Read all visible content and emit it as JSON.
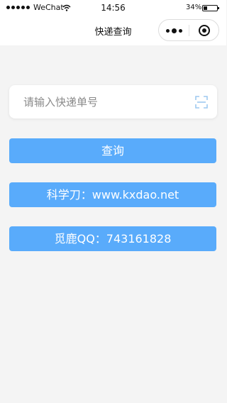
{
  "status_bar": {
    "carrier": "WeChat",
    "time": "14:56",
    "battery": "34%"
  },
  "nav": {
    "title": "快递查询"
  },
  "search": {
    "placeholder": "请输入快递单号",
    "value": ""
  },
  "buttons": {
    "query": "查询",
    "site": "科学刀：www.kxdao.net",
    "qq": "觅鹿QQ：743161828"
  },
  "colors": {
    "button": "#59abfb",
    "background": "#f4f4f4",
    "scan_icon": "#9ec9f0"
  },
  "icons": {
    "wifi": "wifi-icon",
    "battery": "battery-icon",
    "more": "more-icon",
    "close": "close-miniprogram-icon",
    "scan": "scan-icon"
  }
}
